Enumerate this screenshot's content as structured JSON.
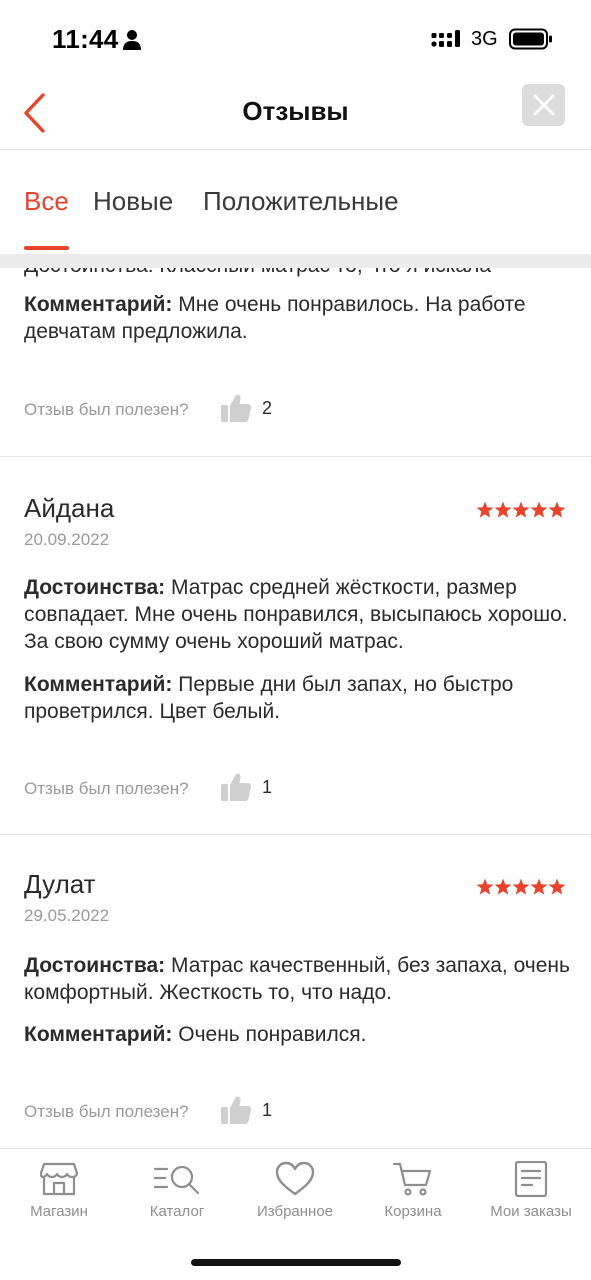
{
  "status_bar": {
    "time": "11:44",
    "network": "3G",
    "icons": [
      "person-icon",
      "signal-icon",
      "battery-icon"
    ]
  },
  "header": {
    "title": "Отзывы",
    "back_icon": "chevron-left-icon",
    "close_icon": "close-icon"
  },
  "tabs": [
    {
      "label": "Все",
      "active": true
    },
    {
      "label": "Новые",
      "active": false
    },
    {
      "label": "Положительные",
      "active": false
    }
  ],
  "reviews": [
    {
      "partial_line": "Достоинства: Классный матрас то, что я искала",
      "comment_label": "Комментарий:",
      "comment": "Мне очень понравилось. На работе девчатам предложила.",
      "helpful_label": "Отзыв был полезен?",
      "helpful_count": "2"
    },
    {
      "author": "Айдана",
      "date": "20.09.2022",
      "rating": 5,
      "pros_label": "Достоинства:",
      "pros": "Матрас средней жёсткости, размер совпадает. Мне очень понравился, высыпаюсь хорошо. За свою сумму очень хороший матрас.",
      "comment_label": "Комментарий:",
      "comment": "Первые дни был запах, но быстро проветрился. Цвет белый.",
      "helpful_label": "Отзыв был полезен?",
      "helpful_count": "1"
    },
    {
      "author": "Дулат",
      "date": "29.05.2022",
      "rating": 5,
      "pros_label": "Достоинства:",
      "pros": "Матрас качественный, без запаха, очень комфортный. Жесткость то, что надо.",
      "comment_label": "Комментарий:",
      "comment": "Очень понравился.",
      "helpful_label": "Отзыв был полезен?",
      "helpful_count": "1"
    }
  ],
  "tab_bar": [
    {
      "label": "Магазин",
      "icon": "shop-icon"
    },
    {
      "label": "Каталог",
      "icon": "catalog-search-icon"
    },
    {
      "label": "Избранное",
      "icon": "heart-icon"
    },
    {
      "label": "Корзина",
      "icon": "cart-icon"
    },
    {
      "label": "Мои заказы",
      "icon": "orders-icon"
    }
  ],
  "colors": {
    "accent": "#e8432c",
    "star": "#e8432c",
    "muted": "#9a9a9a",
    "text": "#2b2b2b"
  }
}
